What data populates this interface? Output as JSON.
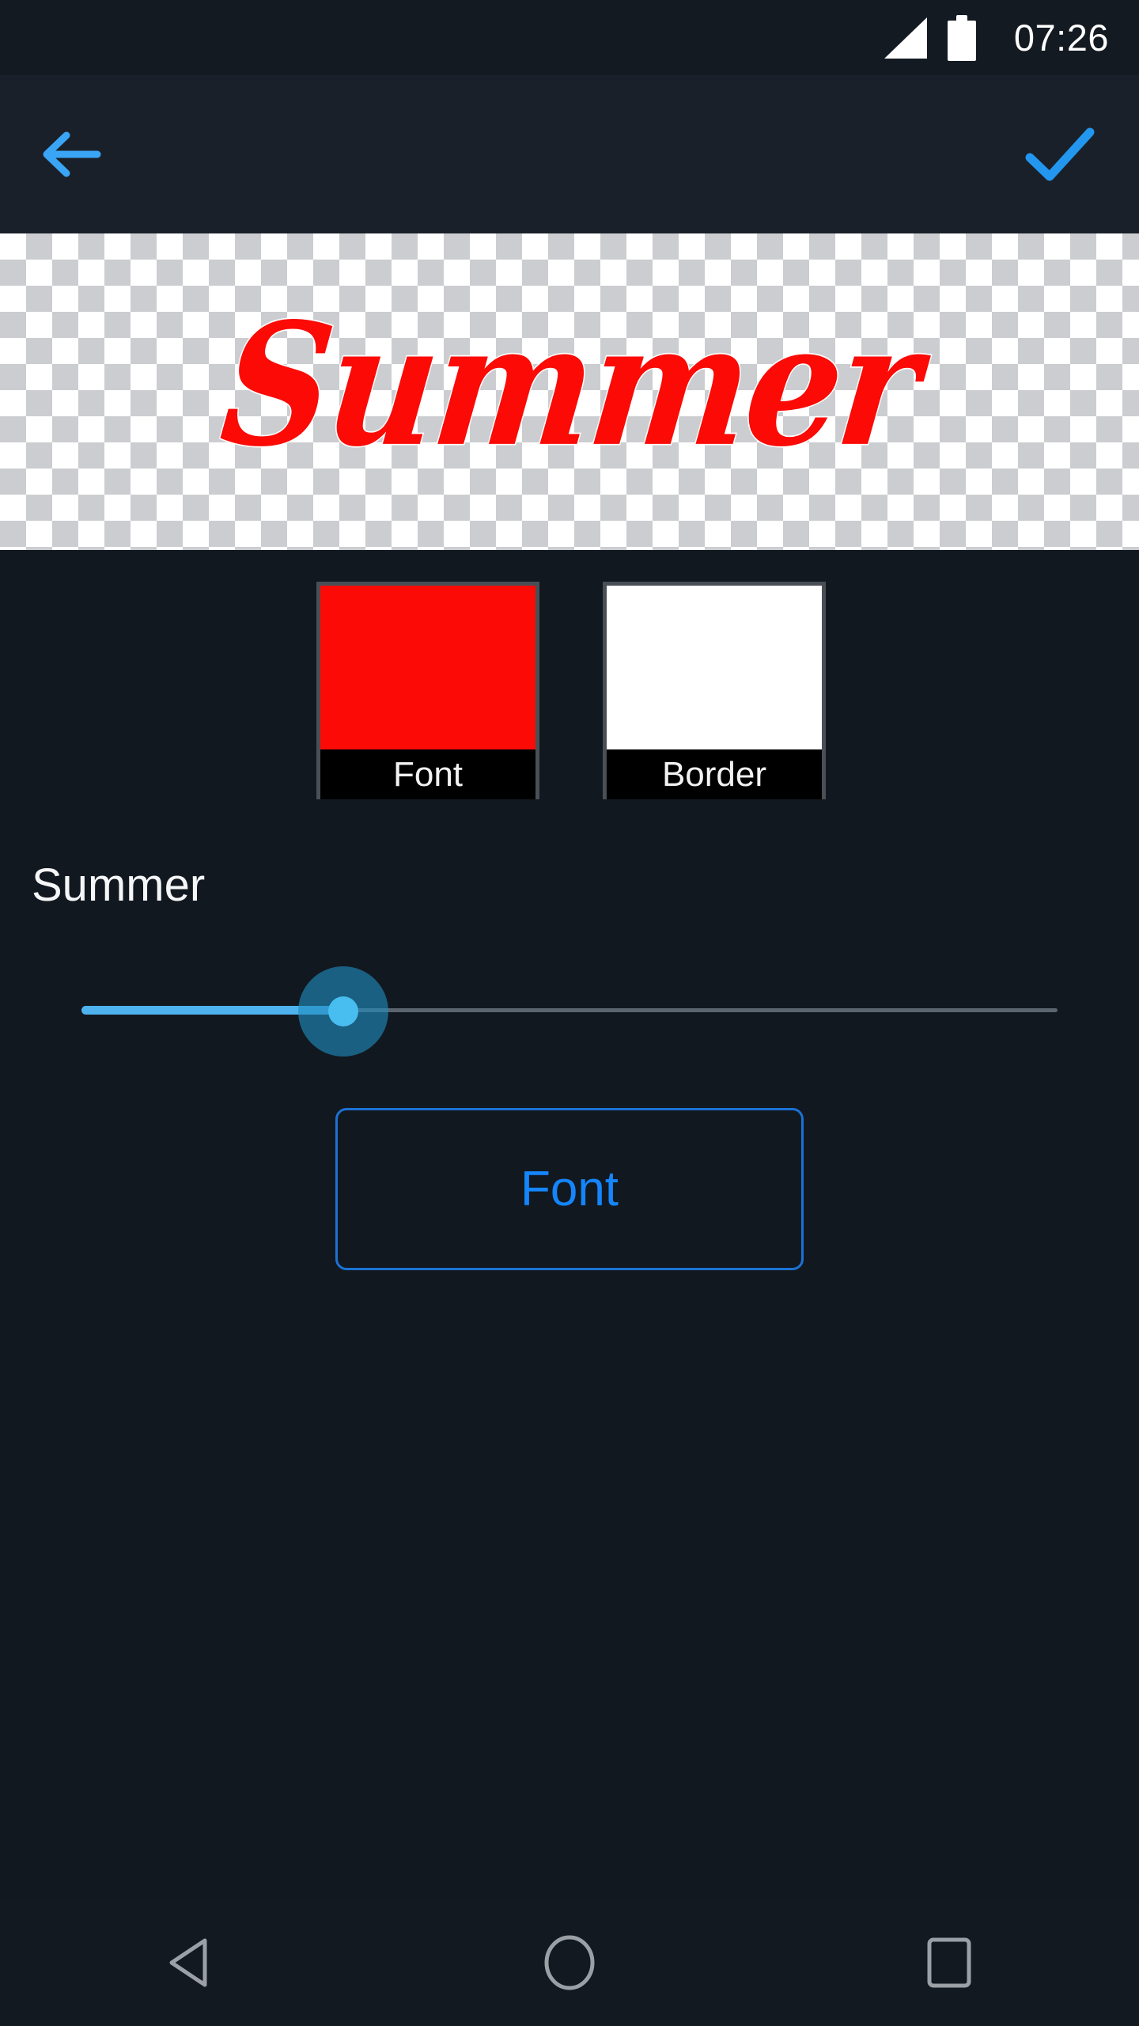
{
  "status_bar": {
    "time": "07:26",
    "signal_icon": "signal-bars-icon",
    "battery_icon": "battery-full-icon"
  },
  "toolbar": {
    "back_icon": "arrow-left-icon",
    "confirm_icon": "check-icon",
    "accent_color": "#3aa5f5"
  },
  "preview": {
    "text": "Summer",
    "text_color": "#fb0a06",
    "border_color": "#ffffff",
    "background": "transparent-checkerboard"
  },
  "swatches": [
    {
      "name": "font",
      "label": "Font",
      "color": "#fb0a06"
    },
    {
      "name": "border",
      "label": "Border",
      "color": "#ffffff"
    }
  ],
  "text_field": {
    "value": "Summer"
  },
  "size_slider": {
    "value_fraction": 0.27,
    "fill_color": "#4eb3ee",
    "thumb_color": "#48bdf0",
    "track_color": "#5b6570"
  },
  "font_button": {
    "label": "Font",
    "text_color": "#1585fc",
    "border_color": "#1b72d4"
  },
  "nav_bar": {
    "back_icon": "triangle-back-icon",
    "home_icon": "circle-home-icon",
    "recents_icon": "square-recents-icon",
    "icon_color": "#9aa0a6"
  }
}
